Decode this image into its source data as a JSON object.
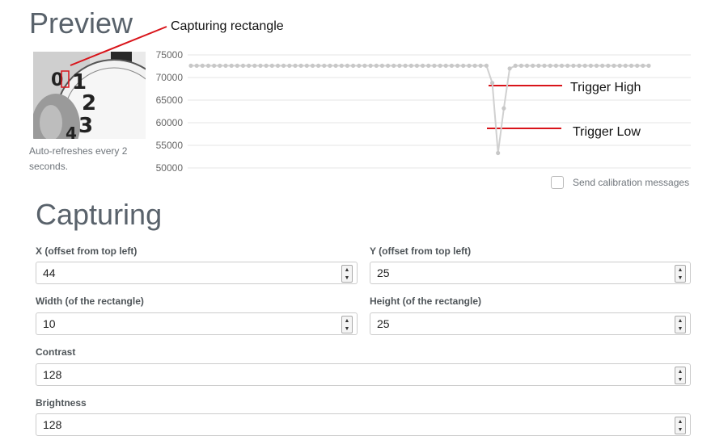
{
  "preview": {
    "title": "Preview",
    "caption": "Auto-refreshes every 2 seconds.",
    "thumbnail_digits": [
      "0",
      "1",
      "2",
      "3",
      "4"
    ]
  },
  "annotations": {
    "capturing_rectangle": "Capturing rectangle",
    "trigger_high": "Trigger High",
    "trigger_low": "Trigger Low",
    "color": "#d9141a"
  },
  "chart_data": {
    "type": "line",
    "y_ticks": [
      "75000",
      "70000",
      "65000",
      "60000",
      "55000",
      "50000"
    ],
    "ylim": [
      50000,
      75000
    ],
    "grid": true,
    "series_color": "#d0d0d0",
    "values": [
      72600,
      72600,
      72600,
      72600,
      72600,
      72600,
      72600,
      72600,
      72600,
      72600,
      72600,
      72600,
      72600,
      72600,
      72600,
      72600,
      72600,
      72600,
      72600,
      72600,
      72600,
      72600,
      72600,
      72600,
      72600,
      72600,
      72600,
      72600,
      72600,
      72600,
      72600,
      72600,
      72600,
      72600,
      72600,
      72600,
      72600,
      72600,
      72600,
      72600,
      72600,
      72600,
      72600,
      72600,
      72600,
      72600,
      72600,
      72600,
      72600,
      72600,
      72600,
      72600,
      68800,
      53300,
      63200,
      72000,
      72600,
      72600,
      72600,
      72600,
      72600,
      72600,
      72600,
      72600,
      72600,
      72600,
      72600,
      72600,
      72600,
      72600,
      72600,
      72600,
      72600,
      72600,
      72600,
      72600,
      72600,
      72600,
      72600,
      72600
    ],
    "trigger_high": 68500,
    "trigger_low": 58500
  },
  "calibration": {
    "label": "Send calibration messages",
    "checked": false
  },
  "capturing": {
    "title": "Capturing",
    "fields": {
      "x": {
        "label": "X (offset from top left)",
        "value": "44"
      },
      "y": {
        "label": "Y (offset from top left)",
        "value": "25"
      },
      "width": {
        "label": "Width (of the rectangle)",
        "value": "10"
      },
      "height": {
        "label": "Height (of the rectangle)",
        "value": "25"
      },
      "contrast": {
        "label": "Contrast",
        "value": "128"
      },
      "brightness": {
        "label": "Brightness",
        "value": "128"
      }
    }
  }
}
